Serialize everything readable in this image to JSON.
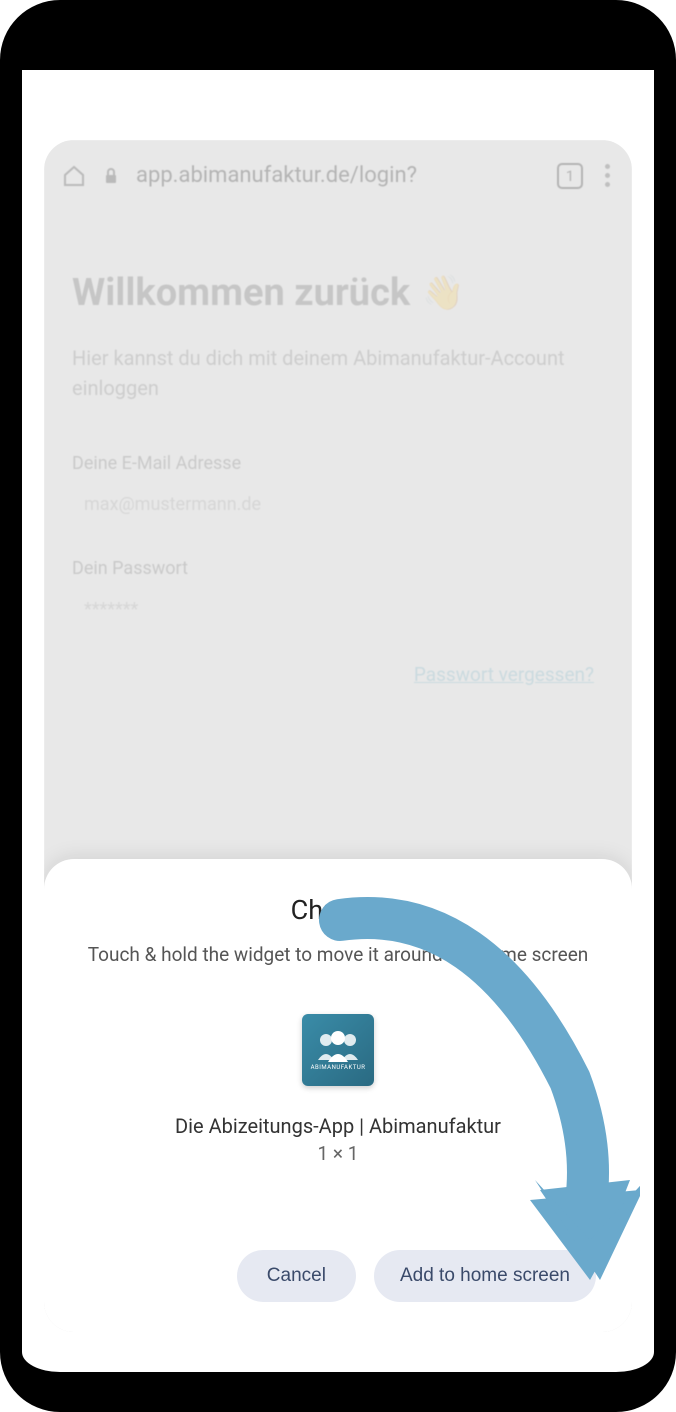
{
  "browser": {
    "url": "app.abimanufaktur.de/login?",
    "tab_count": "1"
  },
  "page": {
    "heading": "Willkommen zurück",
    "heading_emoji": "👋",
    "subheading": "Hier kannst du dich mit deinem Abimanufaktur-Account einloggen",
    "email_label": "Deine E-Mail Adresse",
    "email_placeholder": "max@mustermann.de",
    "password_label": "Dein Passwort",
    "password_placeholder": "*******",
    "forgot_link": "Passwort vergessen?"
  },
  "dialog": {
    "title": "Chrome",
    "subtitle": "Touch & hold the widget to move it around the home screen",
    "app_name": "Die Abizeitungs-App | Abimanufaktur",
    "app_size": "1 × 1",
    "app_icon_label": "ABIMANUFAKTUR",
    "cancel_label": "Cancel",
    "confirm_label": "Add to home screen"
  },
  "colors": {
    "accent_teal": "#4a9db8",
    "arrow": "#6aa9cc",
    "button_bg": "#e6e9f2",
    "button_text": "#3a4a6a"
  }
}
